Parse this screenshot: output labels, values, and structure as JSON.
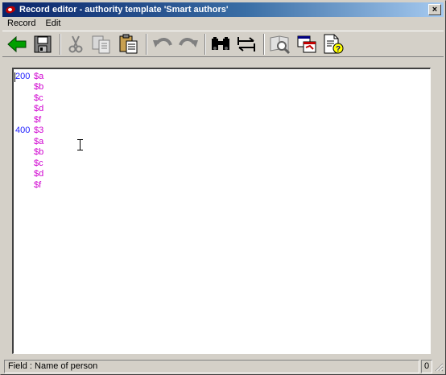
{
  "window": {
    "title": "Record editor - authority template 'Smart authors'",
    "close_label": "×"
  },
  "menu": {
    "items": [
      {
        "label": "Record"
      },
      {
        "label": "Edit"
      }
    ]
  },
  "toolbar": {
    "buttons": [
      {
        "name": "back",
        "icon": "back-arrow-icon"
      },
      {
        "name": "save",
        "icon": "floppy-disk-icon"
      },
      {
        "name": "cut",
        "icon": "scissors-icon"
      },
      {
        "name": "copy",
        "icon": "copy-icon"
      },
      {
        "name": "paste",
        "icon": "paste-icon"
      },
      {
        "name": "undo",
        "icon": "undo-icon"
      },
      {
        "name": "redo",
        "icon": "redo-icon"
      },
      {
        "name": "find",
        "icon": "binoculars-icon"
      },
      {
        "name": "replace",
        "icon": "swap-arrows-icon"
      },
      {
        "name": "browse",
        "icon": "book-search-icon"
      },
      {
        "name": "windows",
        "icon": "windows-icon"
      },
      {
        "name": "help",
        "icon": "document-help-icon"
      }
    ],
    "colors": {
      "back_arrow": "#00a000",
      "tag_text": "#1a1aff",
      "subfield_text": "#d000d0"
    }
  },
  "record": {
    "fields": [
      {
        "tag": "200",
        "subfields": [
          "$a",
          "$b",
          "$c",
          "$d",
          "$f"
        ]
      },
      {
        "tag": "400",
        "subfields": [
          "$3",
          "$a",
          "$b",
          "$c",
          "$d",
          "$f"
        ]
      }
    ]
  },
  "status": {
    "text": "Field : Name of person",
    "count": "0"
  }
}
